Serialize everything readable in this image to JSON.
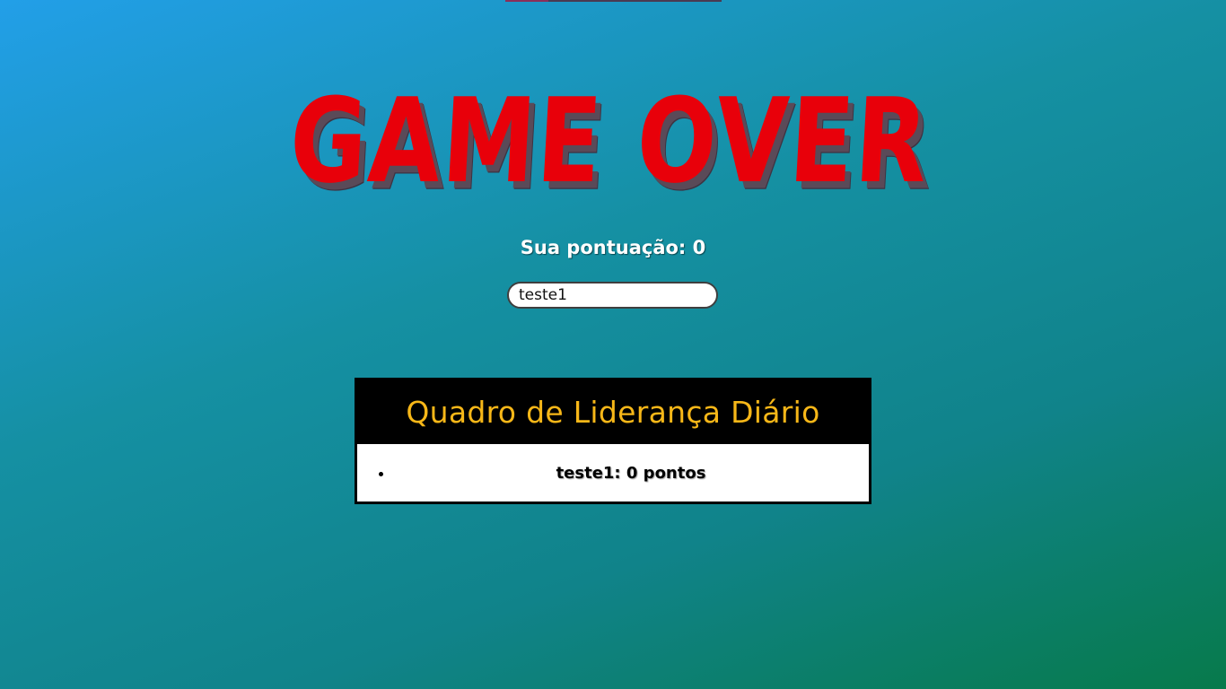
{
  "title": "GAME OVER",
  "score_text": "Sua pontuação: 0",
  "name_input": {
    "value": "teste1"
  },
  "leaderboard": {
    "title": "Quadro de Liderança Diário",
    "entries": [
      {
        "text": "teste1: 0 pontos"
      }
    ]
  },
  "colors": {
    "title": "#e8000a",
    "leaderboard_title": "#f7b718",
    "background_start": "#229fe8",
    "background_end": "#077a4b"
  }
}
